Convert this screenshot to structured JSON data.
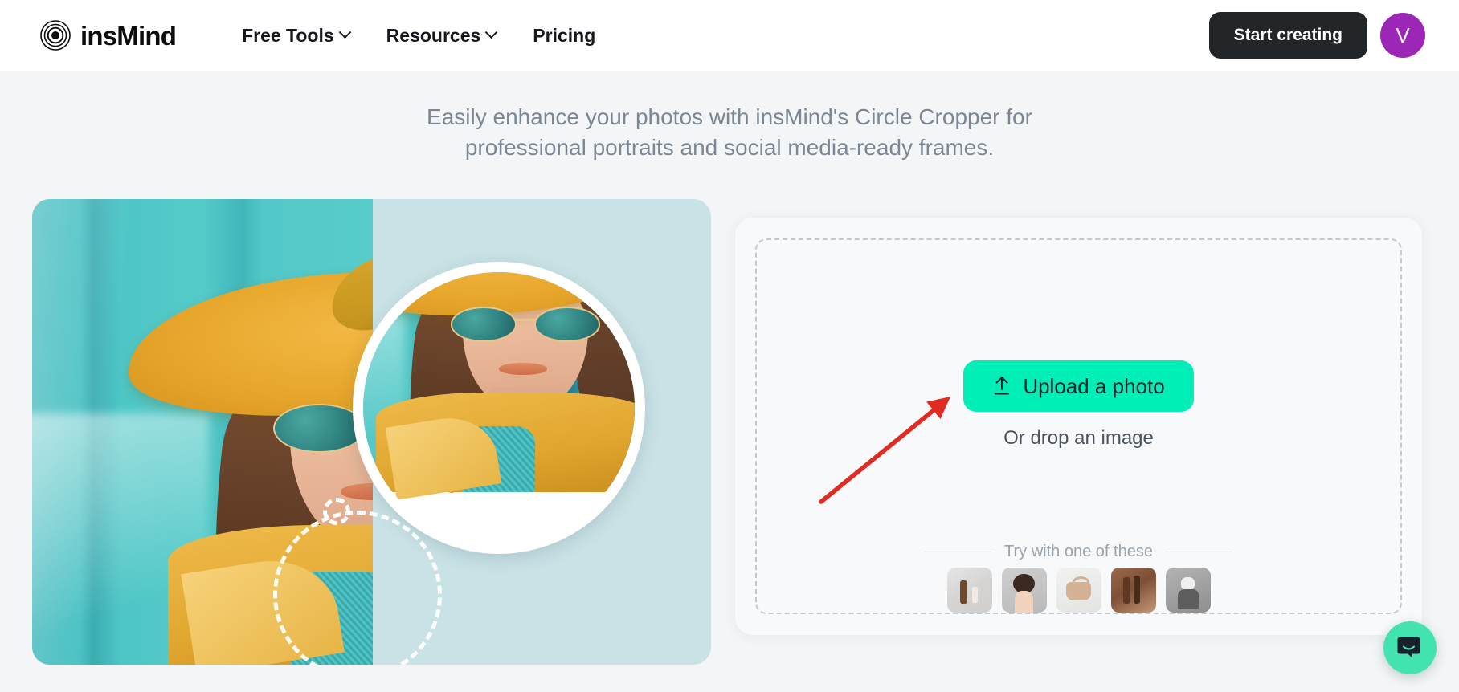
{
  "header": {
    "brand_name": "insMind",
    "nav": [
      {
        "label": "Free Tools",
        "has_dropdown": true
      },
      {
        "label": "Resources",
        "has_dropdown": true
      },
      {
        "label": "Pricing",
        "has_dropdown": false
      }
    ],
    "cta_label": "Start creating",
    "avatar_initial": "V"
  },
  "page": {
    "subtitle": "Easily enhance your photos with insMind's Circle Cropper for professional portraits and social media-ready frames."
  },
  "preview": {
    "before_alt": "Woman in yellow hat and round teal sunglasses against a teal wall",
    "after_alt": "Same portrait cropped into a white-bordered circle on a light blue background"
  },
  "upload": {
    "button_label": "Upload a photo",
    "drop_hint": "Or drop an image",
    "try_label": "Try with one of these",
    "samples": [
      {
        "name": "cosmetic-bottles"
      },
      {
        "name": "woman-curly-hair"
      },
      {
        "name": "beige-handbag"
      },
      {
        "name": "cosmetic-tubes"
      },
      {
        "name": "grey-white-cat"
      }
    ]
  },
  "annotation": {
    "arrow_color": "#e02b23"
  },
  "chat": {
    "label": "Open chat"
  },
  "colors": {
    "accent": "#00efb9",
    "cta_dark": "#232629",
    "avatar_purple": "#9c27b7",
    "page_bg": "#f3f5f6",
    "chat_teal": "#43e3b0",
    "after_bg": "#c9e2e6"
  }
}
